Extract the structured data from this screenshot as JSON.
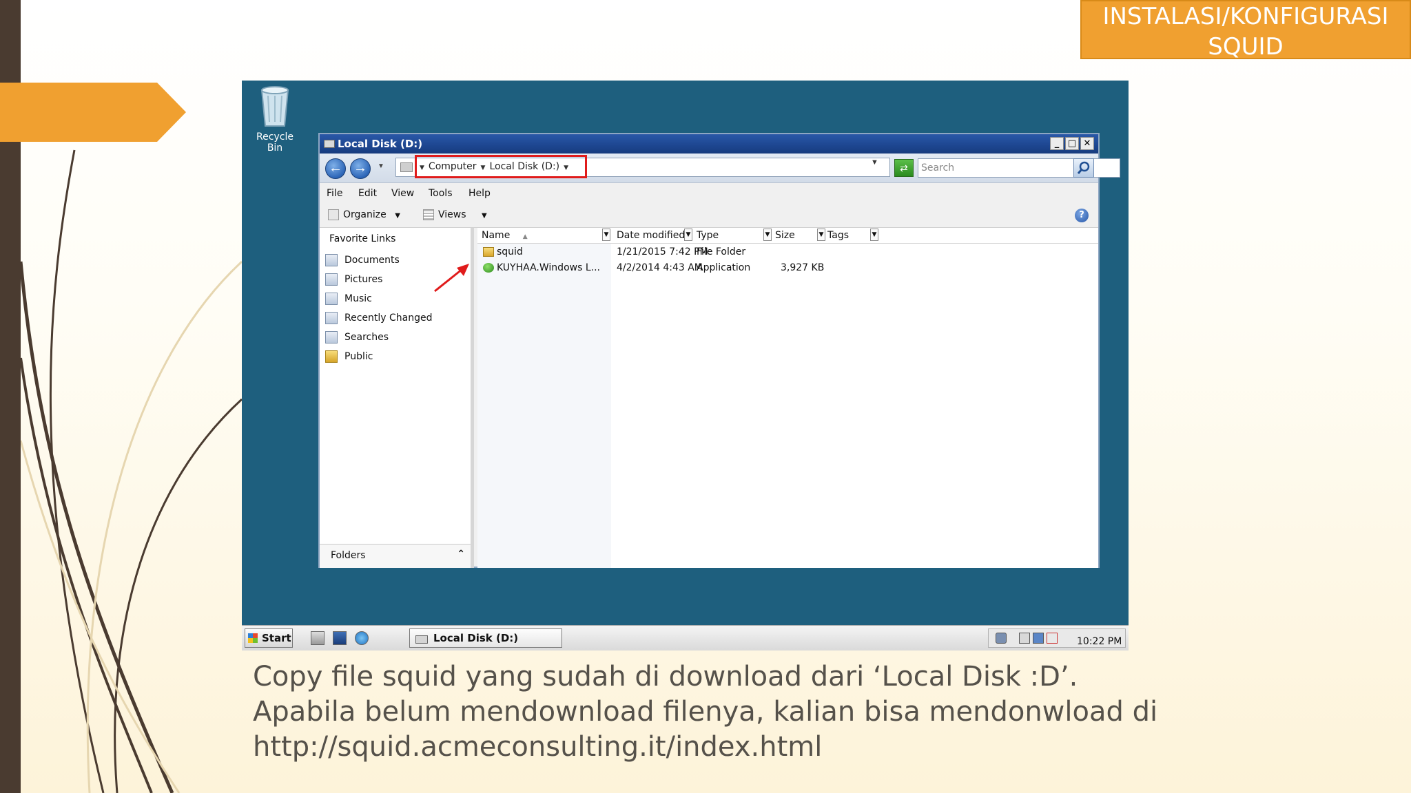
{
  "slide": {
    "title_lines": [
      "INSTALASI/KONFIGURASI",
      "SQUID"
    ],
    "caption_lines": [
      "Copy file squid yang sudah di download dari ‘Local Disk :D’.",
      "Apabila belum mendownload filenya, kalian bisa mendonwload di",
      "http://squid.acmeconsulting.it/index.html"
    ],
    "colors": {
      "accent": "#f0a030",
      "left_bar": "#4a3b30",
      "desktop": "#1e5f7e",
      "highlight": "#e01b1b"
    }
  },
  "desktop": {
    "recycle_bin_label": "Recycle Bin"
  },
  "window": {
    "title": "Local Disk (D:)",
    "controls": {
      "minimize": "_",
      "maximize": "□",
      "close": "✕"
    },
    "address": {
      "crumbs": [
        "Computer",
        "Local Disk (D:)"
      ],
      "search_placeholder": "Search"
    },
    "menu": [
      "File",
      "Edit",
      "View",
      "Tools",
      "Help"
    ],
    "toolbar": {
      "organize": "Organize",
      "views": "Views"
    },
    "nav_pane": {
      "section_title": "Favorite Links",
      "items": [
        {
          "label": "Documents",
          "icon": "documents-icon"
        },
        {
          "label": "Pictures",
          "icon": "pictures-icon"
        },
        {
          "label": "Music",
          "icon": "music-icon"
        },
        {
          "label": "Recently Changed",
          "icon": "recently-changed-icon"
        },
        {
          "label": "Searches",
          "icon": "searches-icon"
        },
        {
          "label": "Public",
          "icon": "folder-icon"
        }
      ],
      "folders_label": "Folders"
    },
    "columns": [
      "Name",
      "Date modified",
      "Type",
      "Size",
      "Tags"
    ],
    "files": [
      {
        "name": "squid",
        "date": "1/21/2015 7:42 PM",
        "type": "File Folder",
        "size": "",
        "icon": "folder-icon"
      },
      {
        "name": "KUYHAA.Windows L...",
        "date": "4/2/2014 4:43 AM",
        "type": "Application",
        "size": "3,927 KB",
        "icon": "application-icon"
      }
    ]
  },
  "taskbar": {
    "start_label": "Start",
    "task_item": "Local Disk (D:)",
    "clock": "10:22 PM"
  }
}
